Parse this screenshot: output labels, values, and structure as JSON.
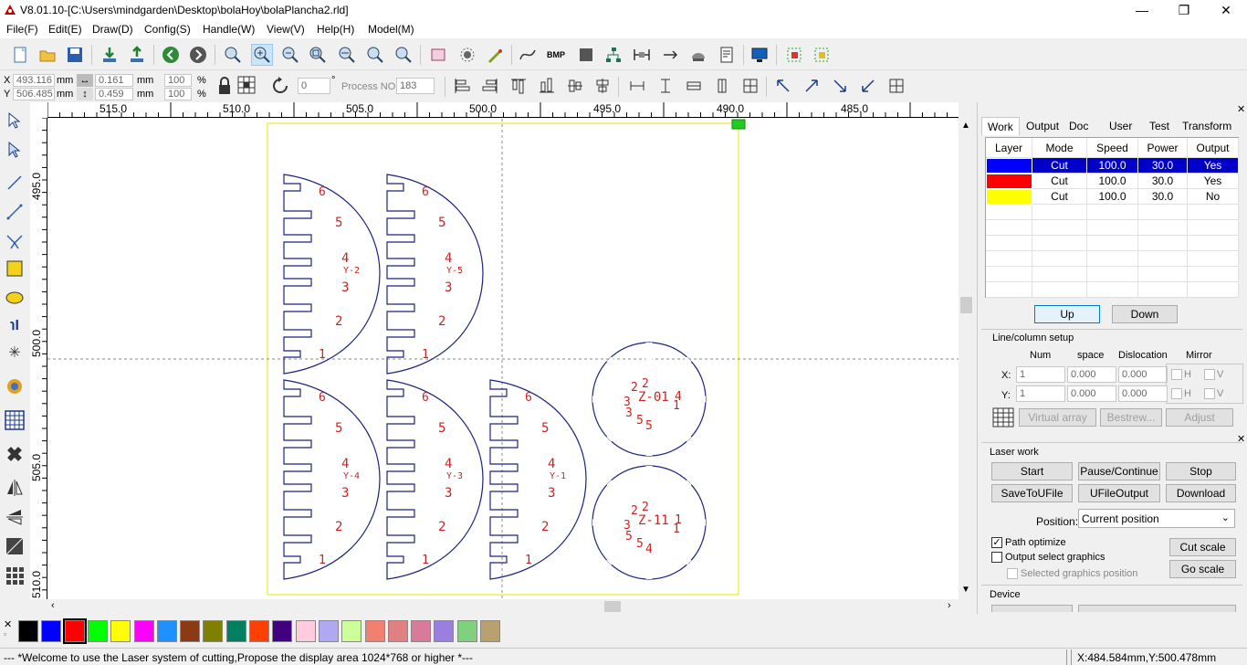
{
  "window": {
    "title": "V8.01.10-[C:\\Users\\mindgarden\\Desktop\\bolaHoy\\bolaPlancha2.rld]"
  },
  "menu": [
    "File(F)",
    "Edit(E)",
    "Draw(D)",
    "Config(S)",
    "Handle(W)",
    "View(V)",
    "Help(H)",
    "Model(M)"
  ],
  "position_fields": {
    "x_label": "X",
    "x_value": "493.116",
    "x_unit": "mm",
    "y_label": "Y",
    "y_value": "506.485",
    "y_unit": "mm",
    "w_value": "0.161",
    "w_unit": "mm",
    "h_value": "0.459",
    "h_unit": "mm",
    "sx_value": "100",
    "sx_unit": "%",
    "sy_value": "100",
    "sy_unit": "%",
    "angle_value": "0",
    "angle_unit": "°",
    "process_label": "Process NO:",
    "process_value": "183"
  },
  "ruler": {
    "h_labels": [
      "515.0",
      "510.0",
      "505.0",
      "500.0",
      "495.0",
      "490.0",
      "485.0"
    ],
    "v_labels": [
      "495.0",
      "500.0",
      "505.0",
      "510.0"
    ]
  },
  "canvas": {
    "semis": [
      {
        "top": [
          "6",
          "5"
        ],
        "mid": "4",
        "tag": "Y-2",
        "bottom": [
          "3",
          "2",
          "1"
        ]
      },
      {
        "top": [
          "6",
          "5"
        ],
        "mid": "4",
        "tag": "Y-5",
        "bottom": [
          "3",
          "2",
          "1"
        ]
      },
      {
        "top": [
          "6",
          "5"
        ],
        "mid": "4",
        "tag": "Y-4",
        "bottom": [
          "3",
          "2",
          "1"
        ]
      },
      {
        "top": [
          "6",
          "5"
        ],
        "mid": "4",
        "tag": "Y-3",
        "bottom": [
          "3",
          "2",
          "1"
        ]
      },
      {
        "top": [
          "6",
          "5"
        ],
        "mid": "4",
        "tag": "Y-1",
        "bottom": [
          "3",
          "2",
          "1"
        ]
      }
    ],
    "discs": [
      {
        "tag": "Z-01",
        "marks": [
          "2",
          "2",
          "3",
          "3",
          "5",
          "5",
          "4",
          "1"
        ]
      },
      {
        "tag": "Z-11",
        "marks": [
          "2",
          "2",
          "3",
          "5",
          "5",
          "4",
          "1",
          "1"
        ]
      }
    ]
  },
  "right_panel": {
    "tabs": [
      "Work",
      "Output",
      "Doc",
      "User",
      "Test",
      "Transform"
    ],
    "active_tab": "Work",
    "layer_headers": [
      "Layer",
      "Mode",
      "Speed",
      "Power",
      "Output"
    ],
    "layers": [
      {
        "color": "#0000ff",
        "mode": "Cut",
        "speed": "100.0",
        "power": "30.0",
        "output": "Yes",
        "selected": true
      },
      {
        "color": "#ff0000",
        "mode": "Cut",
        "speed": "100.0",
        "power": "30.0",
        "output": "Yes",
        "selected": false
      },
      {
        "color": "#ffff00",
        "mode": "Cut",
        "speed": "100.0",
        "power": "30.0",
        "output": "No",
        "selected": false
      }
    ],
    "up_label": "Up",
    "down_label": "Down",
    "linecol": {
      "title": "Line/column setup",
      "headers": [
        "Num",
        "space",
        "Dislocation",
        "Mirror"
      ],
      "x_label": "X:",
      "y_label": "Y:",
      "x_num": "1",
      "x_space": "0.000",
      "x_disloc": "0.000",
      "y_num": "1",
      "y_space": "0.000",
      "y_disloc": "0.000",
      "mirror_h": "H",
      "mirror_v": "V",
      "virtual_array": "Virtual array",
      "bestrew": "Bestrew...",
      "adjust": "Adjust"
    },
    "laser_work": {
      "title": "Laser work",
      "start": "Start",
      "pause": "Pause/Continue",
      "stop": "Stop",
      "save_to_u": "SaveToUFile",
      "ufile_output": "UFileOutput",
      "download": "Download",
      "position_label": "Position:",
      "position_value": "Current position",
      "path_optimize": "Path optimize",
      "output_select": "Output select graphics",
      "selected_position": "Selected graphics position",
      "cut_scale": "Cut scale",
      "go_scale": "Go scale"
    },
    "device_title": "Device"
  },
  "palette": [
    "#000000",
    "#0000ff",
    "#ff0000",
    "#00ff00",
    "#ffff00",
    "#ff00ff",
    "#1e90ff",
    "#8b3a13",
    "#808000",
    "#008060",
    "#ff4000",
    "#400080",
    "#ffccdd",
    "#b0a8f0",
    "#ccff99",
    "#f08070",
    "#e08080",
    "#d87a9a",
    "#9b7fe0",
    "#80d080",
    "#b8a070"
  ],
  "status": {
    "message": "--- *Welcome to use the Laser system of cutting,Propose the display area 1024*768 or higher *---",
    "coords": "X:484.584mm,Y:500.478mm"
  }
}
